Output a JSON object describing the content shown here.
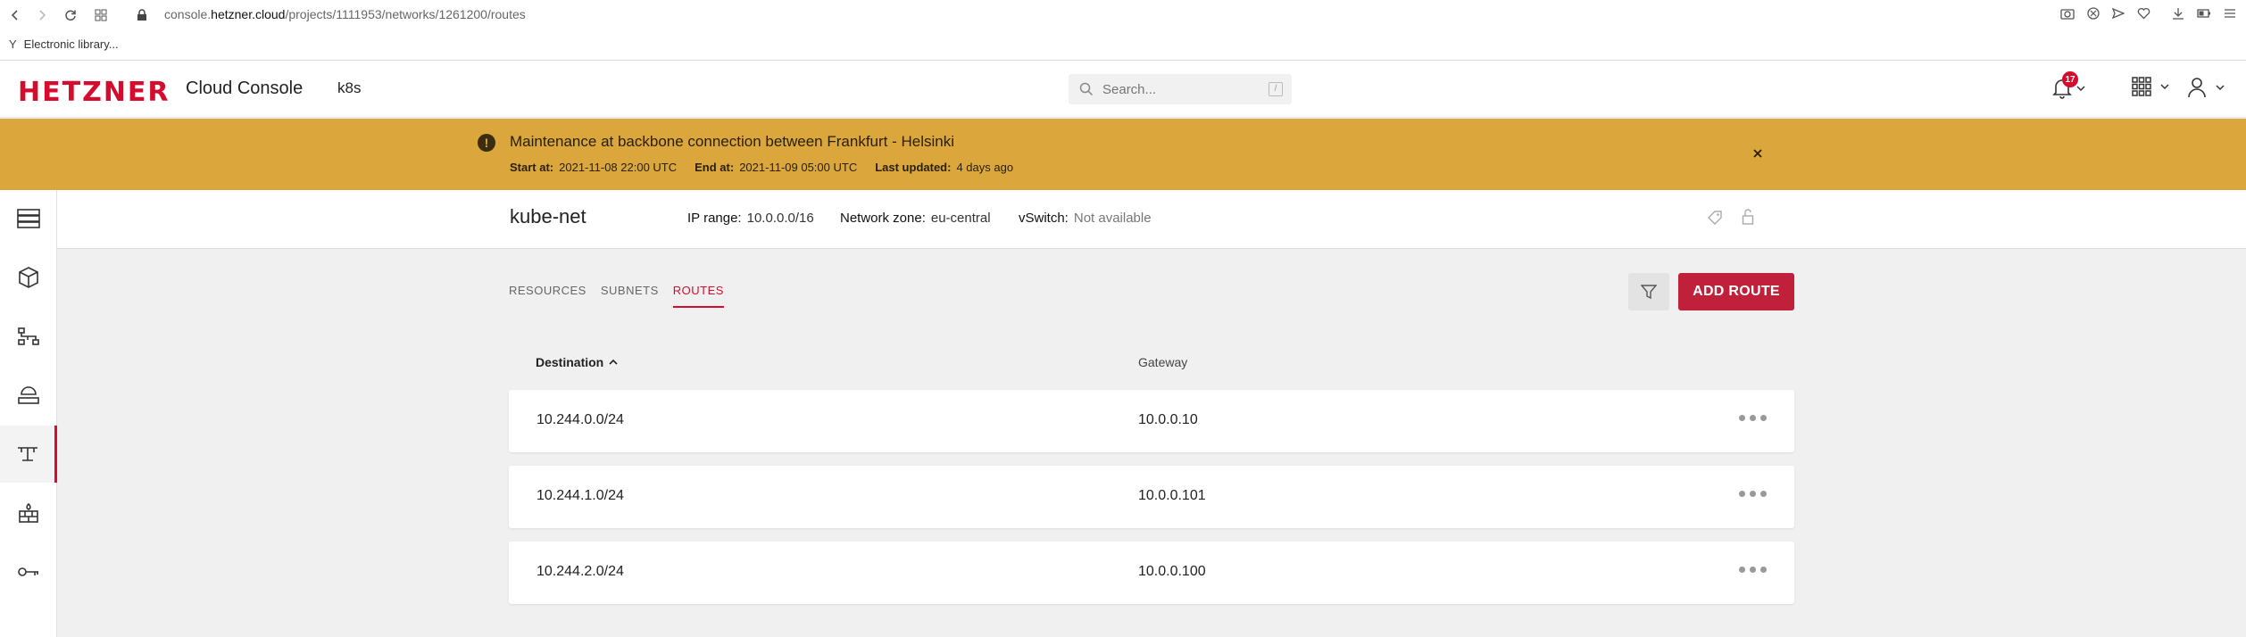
{
  "browser": {
    "url_prefix": "console.",
    "url_host": "hetzner.cloud",
    "url_path": "/projects/1111953/networks/1261200/routes",
    "bookmark": "Electronic library..."
  },
  "header": {
    "logo": "HETZNER",
    "title": "Cloud Console",
    "project": "k8s",
    "search_placeholder": "Search...",
    "search_shortcut": "/",
    "notification_count": "17"
  },
  "banner": {
    "icon": "!",
    "title": "Maintenance at backbone connection between Frankfurt - Helsinki",
    "start_label": "Start at:",
    "start_value": "2021-11-08 22:00 UTC",
    "end_label": "End at:",
    "end_value": "2021-11-09 05:00 UTC",
    "updated_label": "Last updated:",
    "updated_value": "4 days ago"
  },
  "sidebar": {
    "items": [
      {
        "icon": "servers-icon"
      },
      {
        "icon": "volumes-icon"
      },
      {
        "icon": "load-balancer-icon"
      },
      {
        "icon": "floating-ip-icon"
      },
      {
        "icon": "networks-icon",
        "active": true
      },
      {
        "icon": "firewalls-icon"
      },
      {
        "icon": "security-key-icon"
      }
    ]
  },
  "network": {
    "name": "kube-net",
    "ip_range_label": "IP range:",
    "ip_range": "10.0.0.0/16",
    "zone_label": "Network zone:",
    "zone": "eu-central",
    "vswitch_label": "vSwitch:",
    "vswitch": "Not available"
  },
  "tabs": [
    {
      "label": "RESOURCES"
    },
    {
      "label": "SUBNETS"
    },
    {
      "label": "ROUTES",
      "active": true
    }
  ],
  "actions": {
    "add_route": "ADD ROUTE"
  },
  "table": {
    "columns": [
      "Destination",
      "Gateway"
    ],
    "rows": [
      {
        "destination": "10.244.0.0/24",
        "gateway": "10.0.0.10"
      },
      {
        "destination": "10.244.1.0/24",
        "gateway": "10.0.0.101"
      },
      {
        "destination": "10.244.2.0/24",
        "gateway": "10.0.0.100"
      }
    ]
  },
  "colors": {
    "brand": "#d50c2d",
    "banner": "#dba73c",
    "primary_button": "#c0203a"
  }
}
